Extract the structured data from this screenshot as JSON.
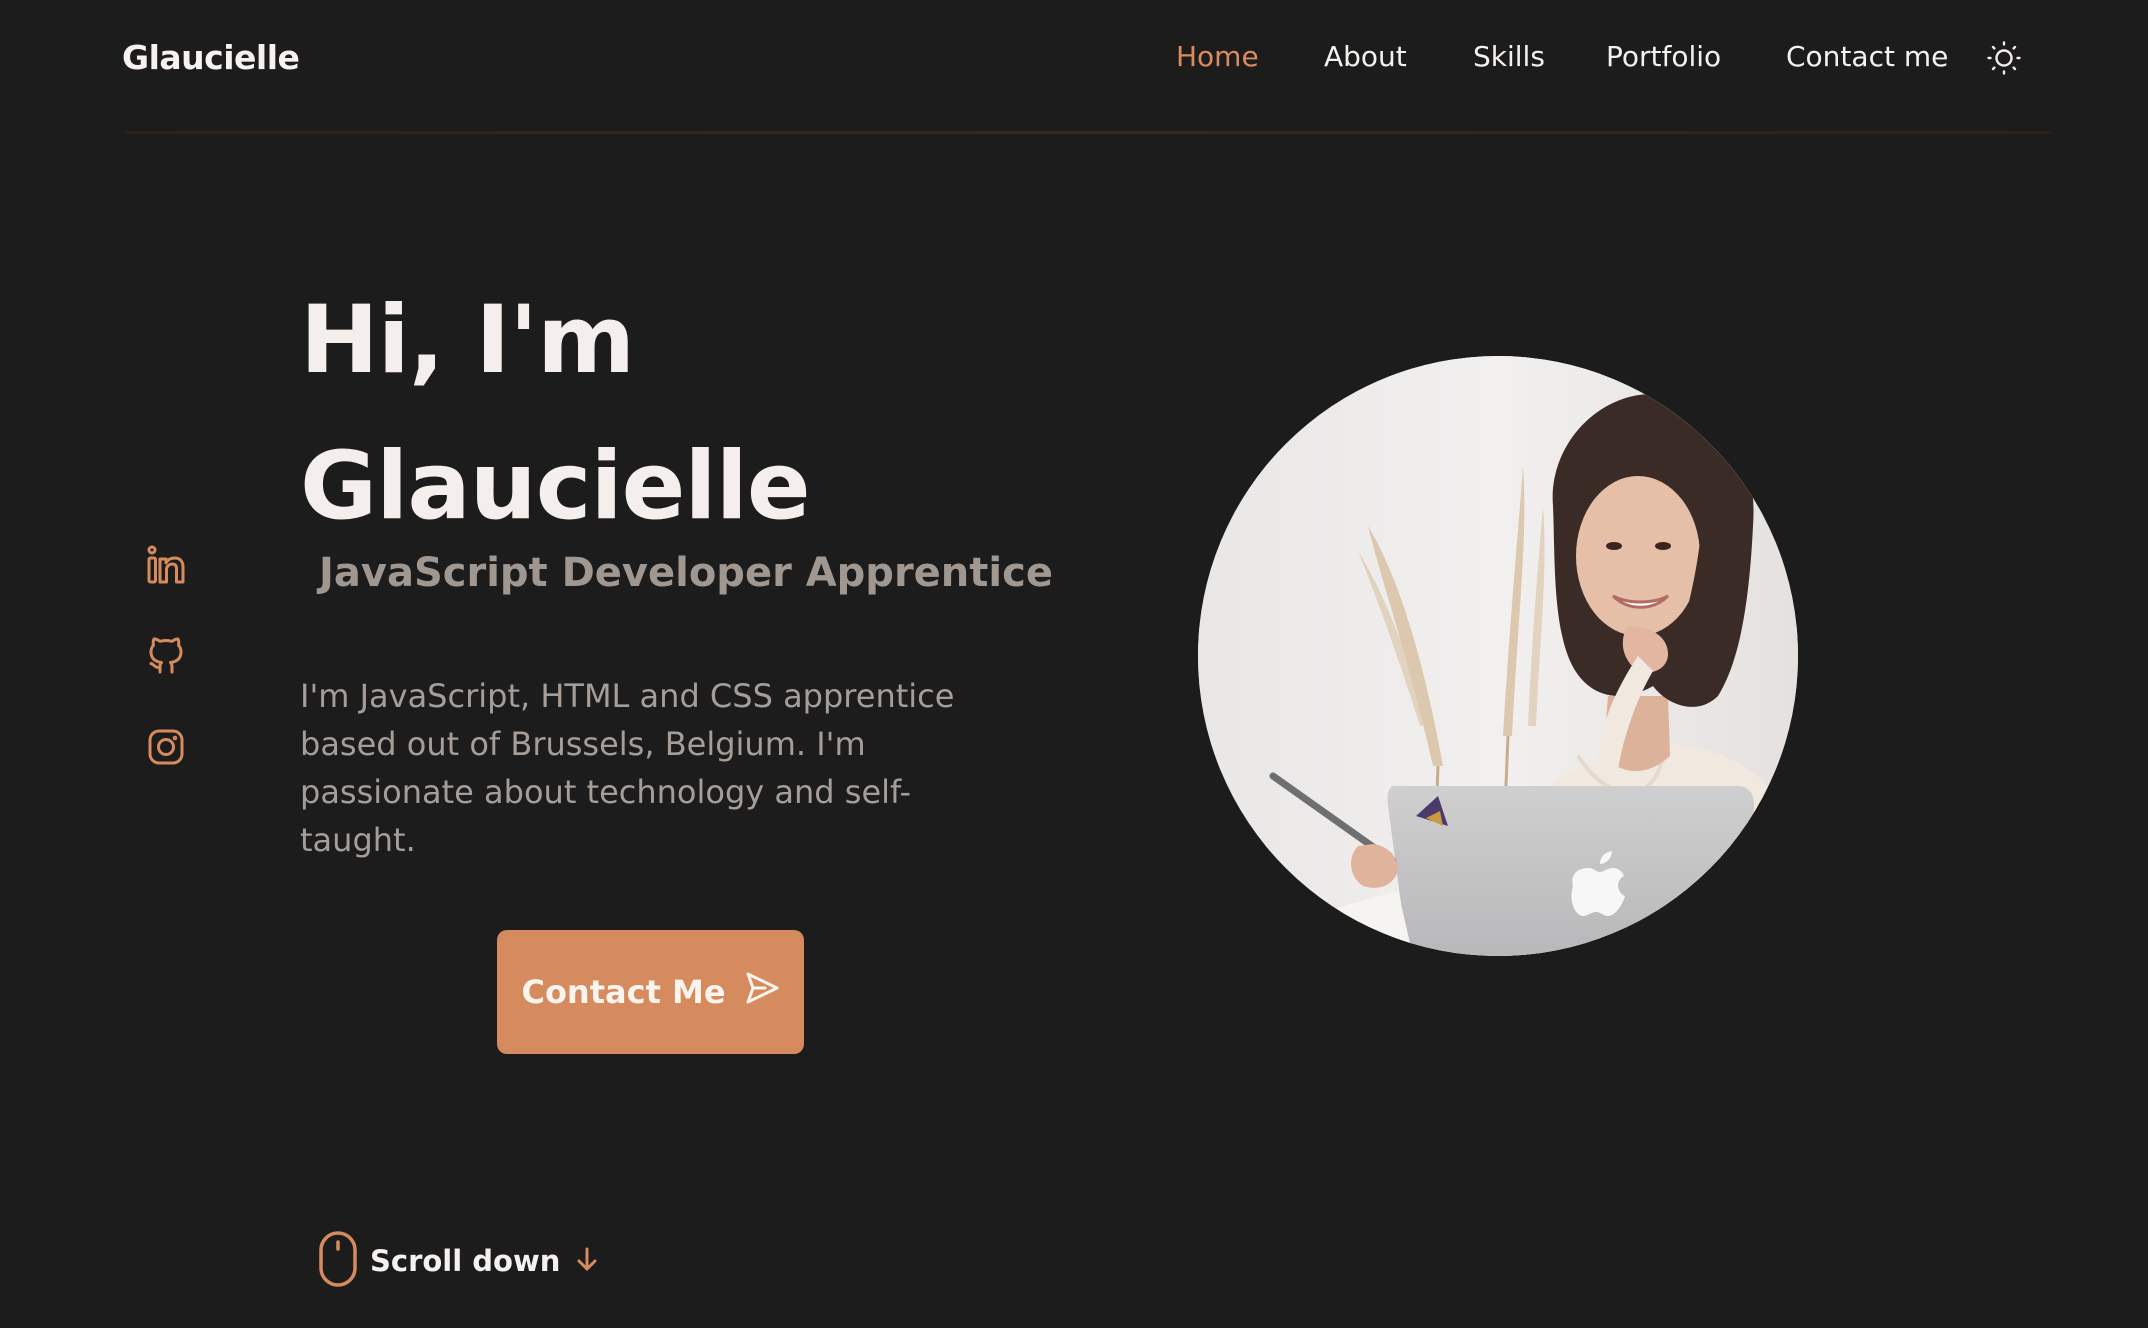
{
  "header": {
    "brand": "Glaucielle",
    "nav": [
      "Home",
      "About",
      "Skills",
      "Portfolio",
      "Contact me"
    ],
    "active": "Home",
    "theme_icon": "sun-icon"
  },
  "social": {
    "icons": [
      "linkedin-icon",
      "github-icon",
      "instagram-icon"
    ]
  },
  "hero": {
    "title_line1": "Hi, I'm",
    "title_line2": "Glaucielle",
    "subtitle": "JavaScript Developer Apprentice",
    "description": "I'm JavaScript, HTML and CSS apprentice based out of Brussels, Belgium. I'm passionate about technology and self-taught.",
    "cta_label": "Contact Me",
    "cta_icon": "send-icon"
  },
  "scroll": {
    "label": "Scroll down",
    "icons": [
      "mouse-icon",
      "arrow-down-icon"
    ]
  },
  "colors": {
    "background": "#1c1c1c",
    "accent": "#d68b5e",
    "heading": "#f4eeec",
    "muted": "#a59d97"
  }
}
